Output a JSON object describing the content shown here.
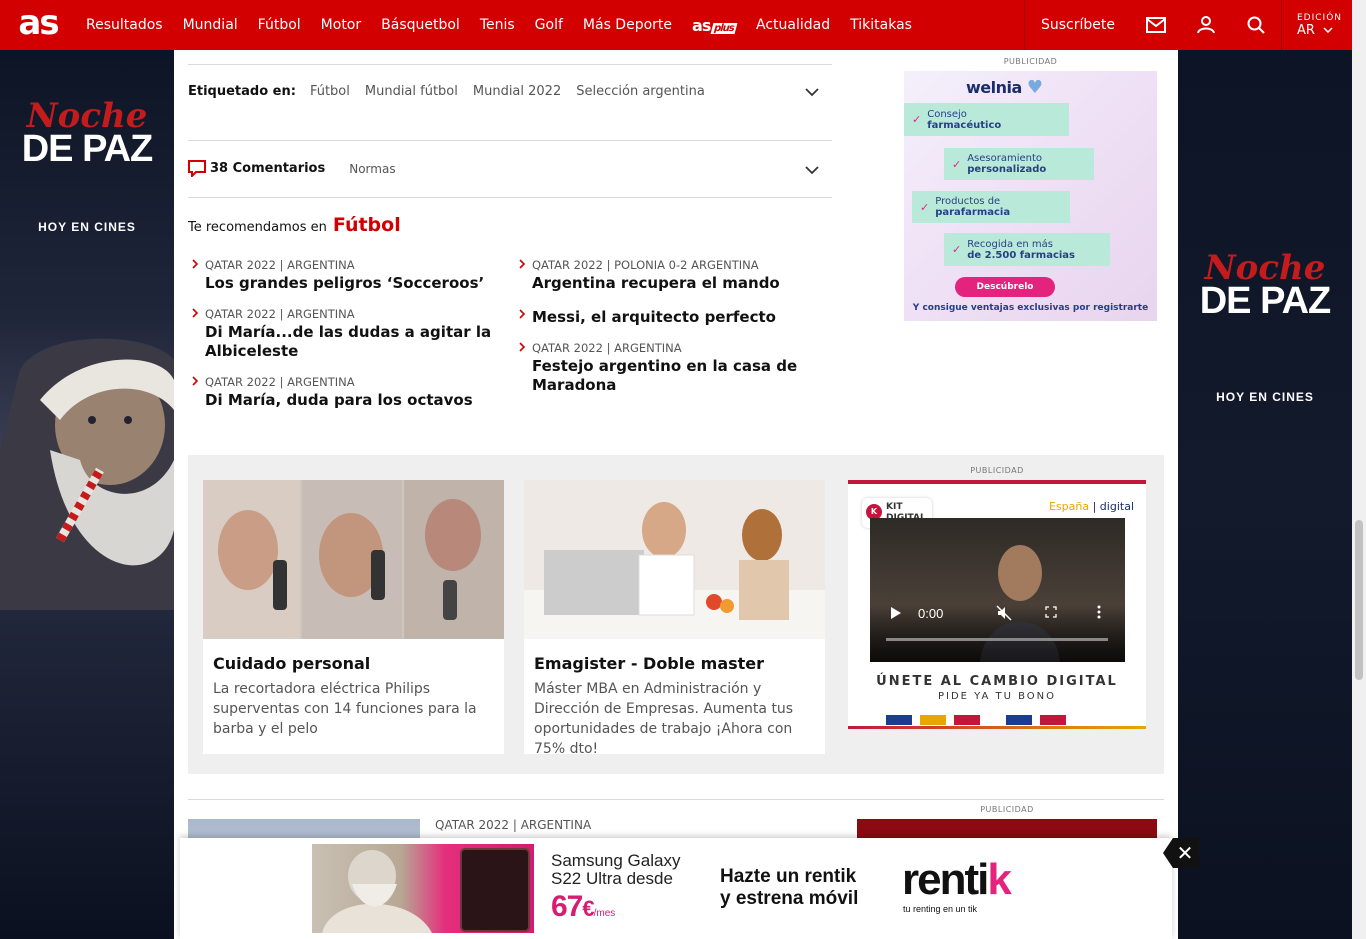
{
  "header": {
    "logo": "as",
    "nav": [
      "Resultados",
      "Mundial",
      "Fútbol",
      "Motor",
      "Básquetbol",
      "Tenis",
      "Golf",
      "Más Deporte"
    ],
    "asplus_label": "as",
    "asplus_badge": "plus",
    "nav2": [
      "Actualidad",
      "Tikitakas"
    ],
    "subscribe": "Suscríbete",
    "edition_label": "EDICIÓN",
    "edition_value": "AR"
  },
  "side_ads": {
    "title": "Noche",
    "subtitle": "DE PAZ",
    "tagline": "HOY EN CINES"
  },
  "tags": {
    "label": "Etiquetado en:",
    "items": [
      "Fútbol",
      "Mundial fútbol",
      "Mundial 2022",
      "Selección argentina"
    ]
  },
  "comments": {
    "count_label": "38 Comentarios",
    "rules": "Normas"
  },
  "recommend": {
    "prefix": "Te recomendamos en",
    "section": "Fútbol",
    "items": [
      {
        "kicker": "QATAR 2022 | ARGENTINA",
        "title": "Los grandes peligros ‘Socceroos’"
      },
      {
        "kicker": "QATAR 2022 | ARGENTINA",
        "title": "Di María...de las dudas a agitar la Albiceleste"
      },
      {
        "kicker": "QATAR 2022 | ARGENTINA",
        "title": "Di María, duda para los octavos"
      },
      {
        "kicker": "QATAR 2022 | POLONIA 0-2 ARGENTINA",
        "title": "Argentina recupera el mando"
      },
      {
        "kicker": "",
        "title": "Messi, el arquitecto perfecto"
      },
      {
        "kicker": "QATAR 2022 | ARGENTINA",
        "title": "Festejo argentino en la casa de Maradona"
      }
    ]
  },
  "ads": {
    "publicidad": "PUBLICIDAD",
    "welnia": {
      "brand": "welnia",
      "items": [
        {
          "l1": "Consejo",
          "l2": "farmacéutico"
        },
        {
          "l1": "Asesoramiento",
          "l2": "personalizado"
        },
        {
          "l1": "Productos de",
          "l2": "parafarmacia"
        },
        {
          "l1": "Recogida en más",
          "l2": "de 2.500 farmacias"
        }
      ],
      "button": "Descúbrelo",
      "footer": "Y consigue ventajas exclusivas por registrarte"
    },
    "kit": {
      "logo_l1": "KIT",
      "logo_l2": "DIGITAL",
      "espana": "España",
      "digital": "| digital",
      "video_time": "0:00",
      "headline": "ÚNETE AL CAMBIO DIGITAL",
      "sub": "PIDE YA TU BONO"
    },
    "sticky": {
      "line1": "Samsung Galaxy",
      "line2": "S22 Ultra desde",
      "price": "67",
      "currency": "€",
      "per": "/mes",
      "hazte1": "Hazte un rentik",
      "hazte2": "y estrena móvil",
      "brand1": "renti",
      "brand2": "k",
      "brand_sub": "tu renting en un tik"
    }
  },
  "promo": [
    {
      "title": "Cuidado personal",
      "desc": "La recortadora eléctrica Philips superventas con 14 funciones para la barba y el pelo"
    },
    {
      "title": "Emagister - Doble master",
      "desc": "Máster MBA en Administración y Dirección de Empresas. Aumenta tus oportunidades de trabajo ¡Ahora con 75% dto!"
    }
  ],
  "bottom_article": {
    "kicker": "QATAR 2022 | ARGENTINA"
  },
  "colors": {
    "brand_red": "#d20000",
    "pink": "#e4237e"
  }
}
